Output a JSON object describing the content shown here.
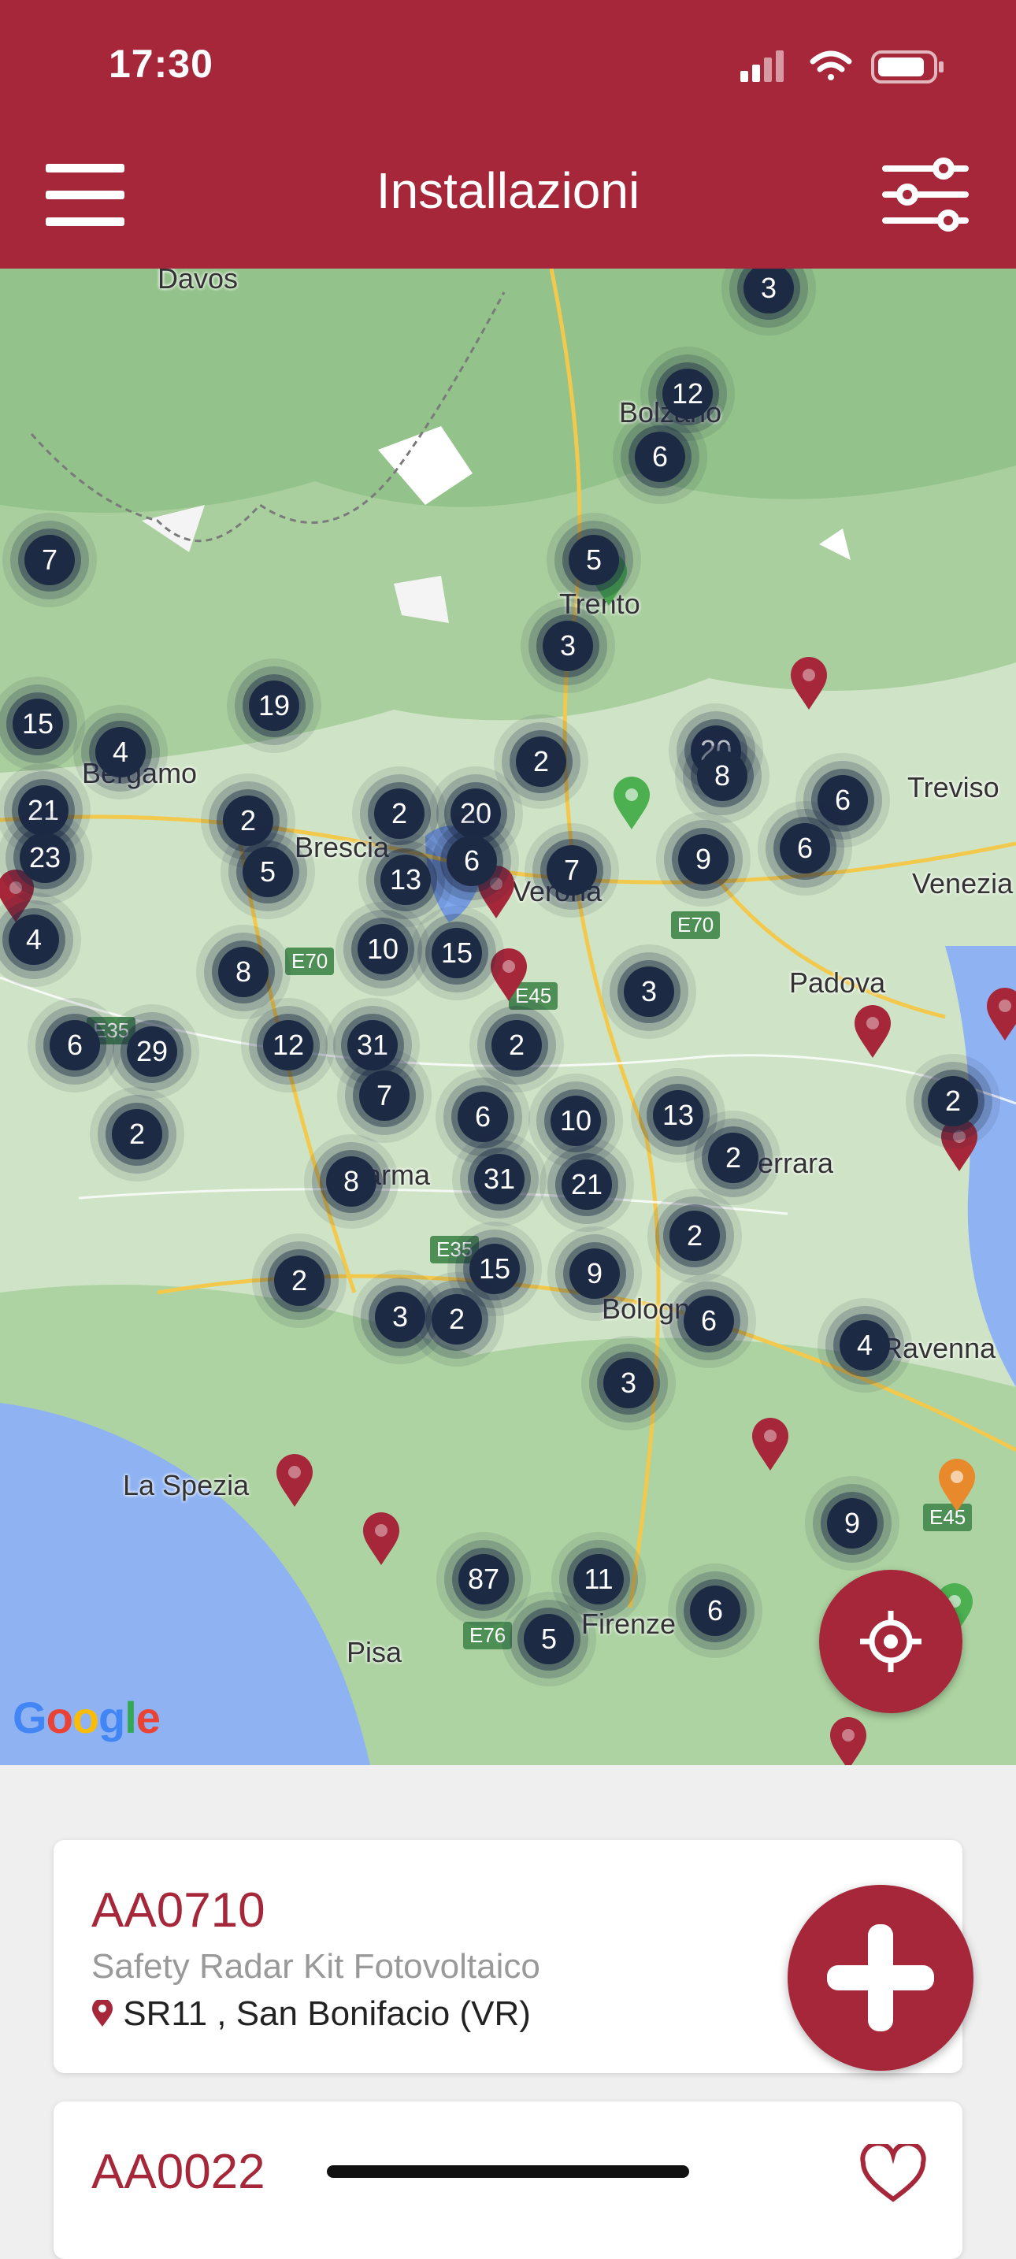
{
  "status_bar": {
    "time": "17:30"
  },
  "header": {
    "title": "Installazioni",
    "menu_icon": "hamburger-icon",
    "filter_icon": "sliders-icon"
  },
  "map": {
    "places": [
      "Davos",
      "Bolzano",
      "Trento",
      "Bergamo",
      "Brescia",
      "Verona",
      "Treviso",
      "Padova",
      "Parma",
      "Bologna",
      "Ravenna",
      "La Spezia",
      "Pisa",
      "Firenze",
      "Venezia",
      "Ferrara"
    ],
    "road_labels": [
      "E70",
      "E70",
      "E45",
      "E35",
      "E45",
      "E76",
      "E35"
    ],
    "clusters": [
      "3",
      "12",
      "6",
      "7",
      "5",
      "3",
      "15",
      "4",
      "19",
      "2",
      "20",
      "8",
      "6",
      "21",
      "23",
      "2",
      "2",
      "20",
      "5",
      "6",
      "13",
      "7",
      "9",
      "6",
      "4",
      "8",
      "10",
      "15",
      "3",
      "6",
      "29",
      "12",
      "31",
      "2",
      "2",
      "7",
      "6",
      "10",
      "13",
      "2",
      "8",
      "31",
      "21",
      "2",
      "2",
      "15",
      "9",
      "3",
      "2",
      "2",
      "6",
      "3",
      "4",
      "9",
      "87",
      "11",
      "5",
      "6"
    ],
    "attribution": "Google"
  },
  "colors": {
    "brand": "#a52739",
    "cluster": "#1d2a44",
    "pin_green": "#4caf50",
    "pin_orange": "#e8892b"
  },
  "cards": [
    {
      "code": "AA0710",
      "description": "Safety Radar Kit Fotovoltaico",
      "location": "SR11 , San Bonifacio (VR)"
    },
    {
      "code": "AA0022"
    }
  ],
  "actions": {
    "locate_icon": "crosshair-icon",
    "add_icon": "plus-icon",
    "favorite_icon": "heart-icon"
  }
}
